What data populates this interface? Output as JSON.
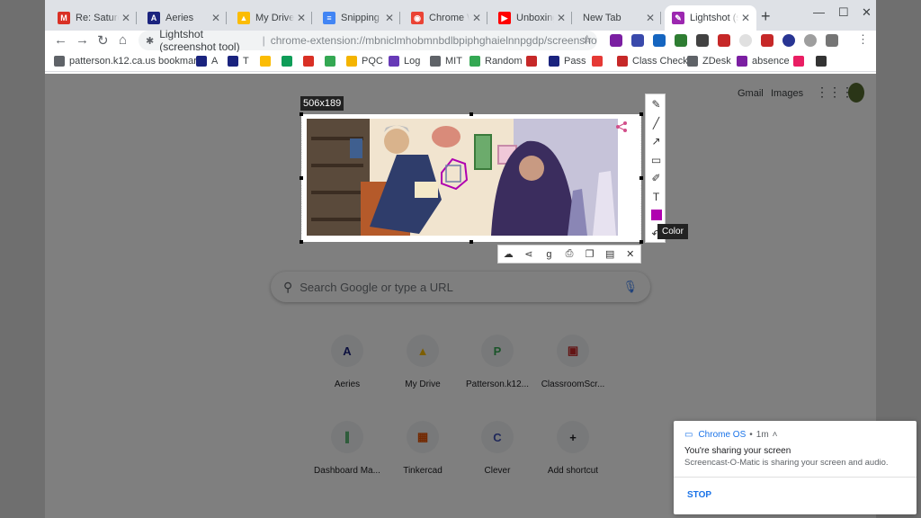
{
  "tabs": [
    {
      "title": "Re: Saturday",
      "icon": "gmail-icon",
      "color": "#d93025",
      "glyph": "M"
    },
    {
      "title": "Aeries",
      "icon": "aeries-icon",
      "color": "#1a237e",
      "glyph": "A"
    },
    {
      "title": "My Drive - Google Drive",
      "icon": "drive-icon",
      "color": "#fbbc04",
      "glyph": "▲"
    },
    {
      "title": "Snipping Tool",
      "icon": "docs-icon",
      "color": "#4285f4",
      "glyph": "≡"
    },
    {
      "title": "Chrome Web Store",
      "icon": "webstore-icon",
      "color": "#ea4335",
      "glyph": "◉"
    },
    {
      "title": "Unboxing the",
      "icon": "youtube-icon",
      "color": "#ff0000",
      "glyph": "▶"
    },
    {
      "title": "New Tab",
      "icon": "",
      "color": "",
      "glyph": ""
    },
    {
      "title": "Lightshot (screenshot tool)",
      "icon": "lightshot-feather-icon",
      "color": "#9c27b0",
      "glyph": "✎"
    }
  ],
  "toolbar": {
    "site_name": "Lightshot (screenshot tool)",
    "url": "chrome-extension://mbniclmhobmnbdlbpiphghaielnnpgdp/screenshot.html?id=screenshot"
  },
  "bookmarks": [
    {
      "label": "patterson.k12.ca.us bookmarks",
      "icon": "folder-icon",
      "color": "#5f6368"
    },
    {
      "label": "A",
      "icon": "aeries-icon",
      "color": "#1a237e"
    },
    {
      "label": "T",
      "icon": "aeries-icon",
      "color": "#1a237e"
    },
    {
      "label": "",
      "icon": "drive-icon",
      "color": "#fbbc04"
    },
    {
      "label": "",
      "icon": "classroom-icon",
      "color": "#0f9d58"
    },
    {
      "label": "",
      "icon": "gmail-icon",
      "color": "#d93025"
    },
    {
      "label": "",
      "icon": "dashboard-icon",
      "color": "#34a853"
    },
    {
      "label": "PQC",
      "icon": "pqc-icon",
      "color": "#f4b400"
    },
    {
      "label": "Log",
      "icon": "log-icon",
      "color": "#673ab7"
    },
    {
      "label": "MIT",
      "icon": "globe-icon",
      "color": "#5f6368"
    },
    {
      "label": "Random",
      "icon": "random-icon",
      "color": "#34a853"
    },
    {
      "label": "",
      "icon": "classroomscreen-icon",
      "color": "#c62828"
    },
    {
      "label": "Pass",
      "icon": "pass-icon",
      "color": "#1a237e"
    },
    {
      "label": "",
      "icon": "bookmark-red-icon",
      "color": "#e53935"
    },
    {
      "label": "Class Check",
      "icon": "classcheck-icon",
      "color": "#c62828"
    },
    {
      "label": "ZDesk",
      "icon": "gear-icon",
      "color": "#5f6368"
    },
    {
      "label": "absence",
      "icon": "absence-icon",
      "color": "#7b1fa2"
    },
    {
      "label": "",
      "icon": "react-icon",
      "color": "#e91e63"
    },
    {
      "label": "",
      "icon": "link-icon",
      "color": "#333333"
    }
  ],
  "page": {
    "gmail": "Gmail",
    "images": "Images",
    "search_placeholder": "Search Google or type a URL",
    "shortcuts": [
      {
        "label": "Aeries",
        "glyph": "A",
        "color": "#1a237e"
      },
      {
        "label": "My Drive",
        "glyph": "▲",
        "color": "#fbbc04"
      },
      {
        "label": "Patterson.k12...",
        "glyph": "P",
        "color": "#34a853"
      },
      {
        "label": "ClassroomScr...",
        "glyph": "▣",
        "color": "#c62828"
      },
      {
        "label": "Dashboard Ma...",
        "glyph": "∥",
        "color": "#34a853"
      },
      {
        "label": "Tinkercad",
        "glyph": "▦",
        "color": "#e65100"
      },
      {
        "label": "Clever",
        "glyph": "C",
        "color": "#3f51b5"
      },
      {
        "label": "Add shortcut",
        "glyph": "+",
        "color": "#202124"
      }
    ]
  },
  "lightshot": {
    "size_label": "506x189",
    "tooltip": "Color",
    "active_color": "#b000b0",
    "vertical_tools": [
      {
        "name": "pen-tool-icon",
        "glyph": "✎"
      },
      {
        "name": "line-tool-icon",
        "glyph": "╱"
      },
      {
        "name": "arrow-tool-icon",
        "glyph": "↗"
      },
      {
        "name": "rectangle-tool-icon",
        "glyph": "▭"
      },
      {
        "name": "marker-tool-icon",
        "glyph": "✐"
      },
      {
        "name": "text-tool-icon",
        "glyph": "T"
      },
      {
        "name": "color-swatch",
        "glyph": ""
      },
      {
        "name": "undo-icon",
        "glyph": "↶"
      }
    ],
    "horizontal_tools": [
      {
        "name": "upload-cloud-icon",
        "glyph": "☁"
      },
      {
        "name": "share-icon",
        "glyph": "⋖"
      },
      {
        "name": "google-search-icon",
        "glyph": "g"
      },
      {
        "name": "print-icon",
        "glyph": "⎙"
      },
      {
        "name": "copy-icon",
        "glyph": "❐"
      },
      {
        "name": "save-icon",
        "glyph": "▤"
      },
      {
        "name": "close-icon",
        "glyph": "✕"
      }
    ]
  },
  "notification": {
    "source": "Chrome OS",
    "time": "1m",
    "title": "You're sharing your screen",
    "body": "Screencast-O-Matic is sharing your screen and audio.",
    "action": "STOP"
  }
}
